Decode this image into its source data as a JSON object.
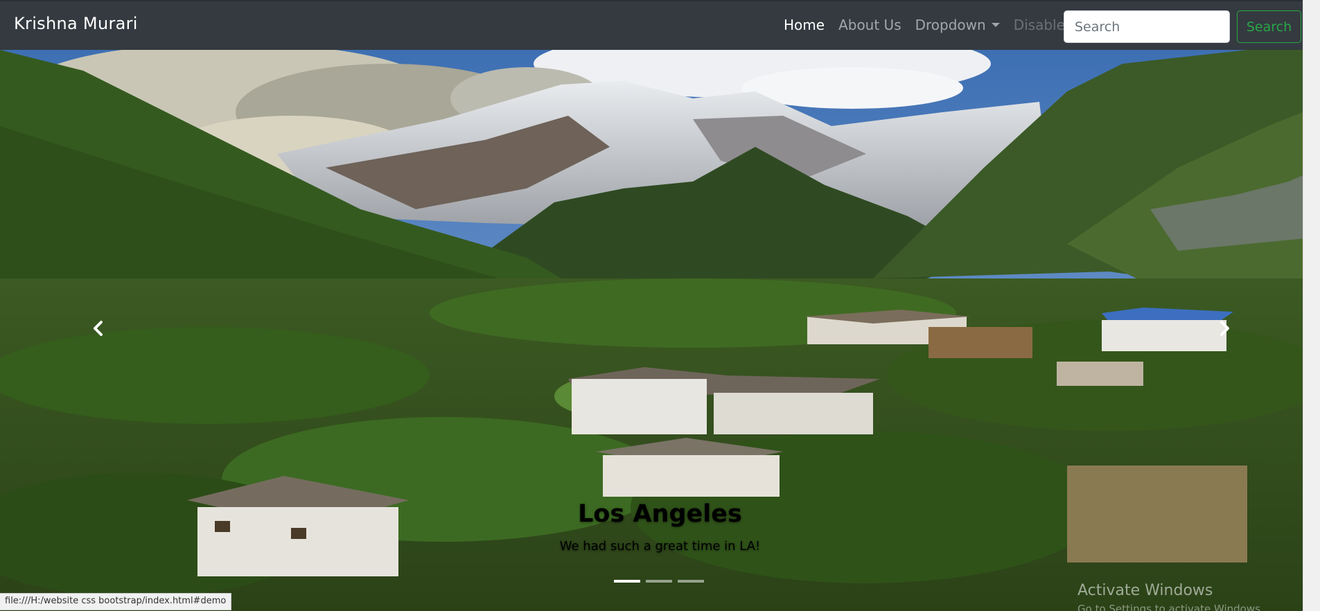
{
  "navbar": {
    "brand": "Krishna Murari",
    "links": [
      {
        "label": "Home",
        "state": "active"
      },
      {
        "label": "About Us",
        "state": "normal"
      },
      {
        "label": "Dropdown",
        "state": "dropdown"
      },
      {
        "label": "Disabled",
        "state": "disabled"
      }
    ],
    "search_placeholder": "Search",
    "search_button": "Search",
    "accent_color": "#28a745",
    "background_color": "#343a40"
  },
  "carousel": {
    "caption_title": "Los Angeles",
    "caption_text": "We had such a great time in LA!",
    "slide_count": 3,
    "active_slide": 1,
    "prev_icon": "chevron-left-icon",
    "next_icon": "chevron-right-icon"
  },
  "status_bar": {
    "url": "file:///H:/website css bootstrap/index.html#demo"
  },
  "overlay": {
    "watermark_title": "Activate Windows",
    "watermark_sub": "Go to Settings to activate Windows."
  }
}
